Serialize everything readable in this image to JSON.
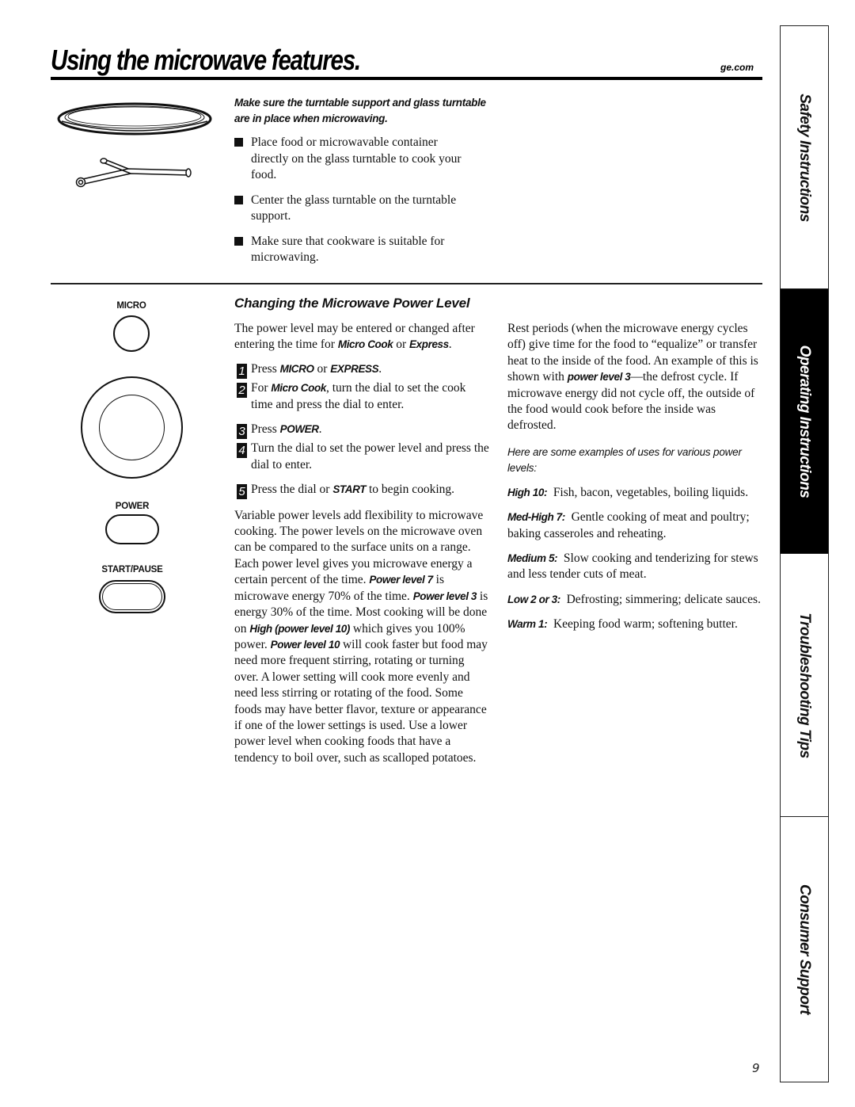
{
  "header": {
    "title": "Using the microwave features.",
    "site": "ge.com"
  },
  "turntable": {
    "note": "Make sure the turntable support and glass turntable are in place when microwaving.",
    "bullets": [
      "Place food or microwavable container directly on the glass turntable to cook your food.",
      "Center the glass turntable on the turntable support.",
      "Make sure that cookware is suitable for microwaving."
    ]
  },
  "control_panel": {
    "micro_label": "MICRO",
    "power_label": "POWER",
    "start_label": "START/PAUSE"
  },
  "power_level": {
    "heading": "Changing the Microwave Power Level",
    "intro_text": "The power level may be entered or changed after entering the time for ",
    "intro_em1": "Micro Cook",
    "intro_or": " or ",
    "intro_em2": "Express",
    "intro_end": ".",
    "steps": [
      {
        "num": "1",
        "pre": "Press ",
        "em1": "MICRO",
        "mid": " or ",
        "em2": "EXPRESS",
        "post": "."
      },
      {
        "num": "2",
        "pre": "For ",
        "em1": "Micro Cook",
        "post": ", turn the dial to set the cook time and press the dial to enter."
      },
      {
        "num": "3",
        "pre": "Press ",
        "em1": "POWER",
        "post": "."
      },
      {
        "num": "4",
        "text": "Turn the dial to set the power level and press the dial to enter."
      },
      {
        "num": "5",
        "pre": "Press the dial or ",
        "em1": "START",
        "post": " to begin cooking."
      }
    ],
    "variable": {
      "t1": "Variable power levels add flexibility to microwave cooking. The power levels on the microwave oven can be compared to the surface units on a range. Each power level gives you microwave energy a certain percent of the time. ",
      "e1": "Power level 7",
      "t2": " is microwave energy 70% of the time. ",
      "e2": "Power level 3",
      "t3": "  is energy 30% of the time. Most cooking will be done on ",
      "e3": "High (power level 10)",
      "t4": " which gives you 100% power. ",
      "e4": "Power level 10",
      "t5": " will cook faster but food may need more frequent stirring, rotating or turning over. A lower setting will cook more evenly and need less stirring or rotating of the food. Some foods may have better flavor, texture or appearance if one of the lower settings is used. Use a lower power level when cooking foods that have a tendency to boil over, such as scalloped potatoes."
    },
    "rest": {
      "t1": "Rest periods (when the microwave energy cycles off) give time for the food to “equalize” or transfer heat to the inside of the food. An example of this is shown with ",
      "e1": "power level 3",
      "t2": "—the defrost cycle. If microwave energy did not cycle off, the outside of the food would cook before the inside was defrosted."
    },
    "examples_intro": "Here are some examples of uses for various power levels:",
    "examples": [
      {
        "level": "High 10:",
        "use": "Fish, bacon, vegetables, boiling liquids."
      },
      {
        "level": "Med-High 7:",
        "use": "Gentle cooking of meat and poultry; baking casseroles and reheating."
      },
      {
        "level": "Medium 5:",
        "use": "Slow cooking and tenderizing for stews and less tender cuts of meat."
      },
      {
        "level": "Low 2 or 3:",
        "use": "Defrosting; simmering; delicate sauces."
      },
      {
        "level": "Warm 1:",
        "use": "Keeping food warm; softening butter."
      }
    ]
  },
  "side_tabs": [
    {
      "label": "Safety Instructions",
      "active": false
    },
    {
      "label": "Operating Instructions",
      "active": true
    },
    {
      "label": "Troubleshooting Tips",
      "active": false
    },
    {
      "label": "Consumer Support",
      "active": false
    }
  ],
  "page_number": "9"
}
